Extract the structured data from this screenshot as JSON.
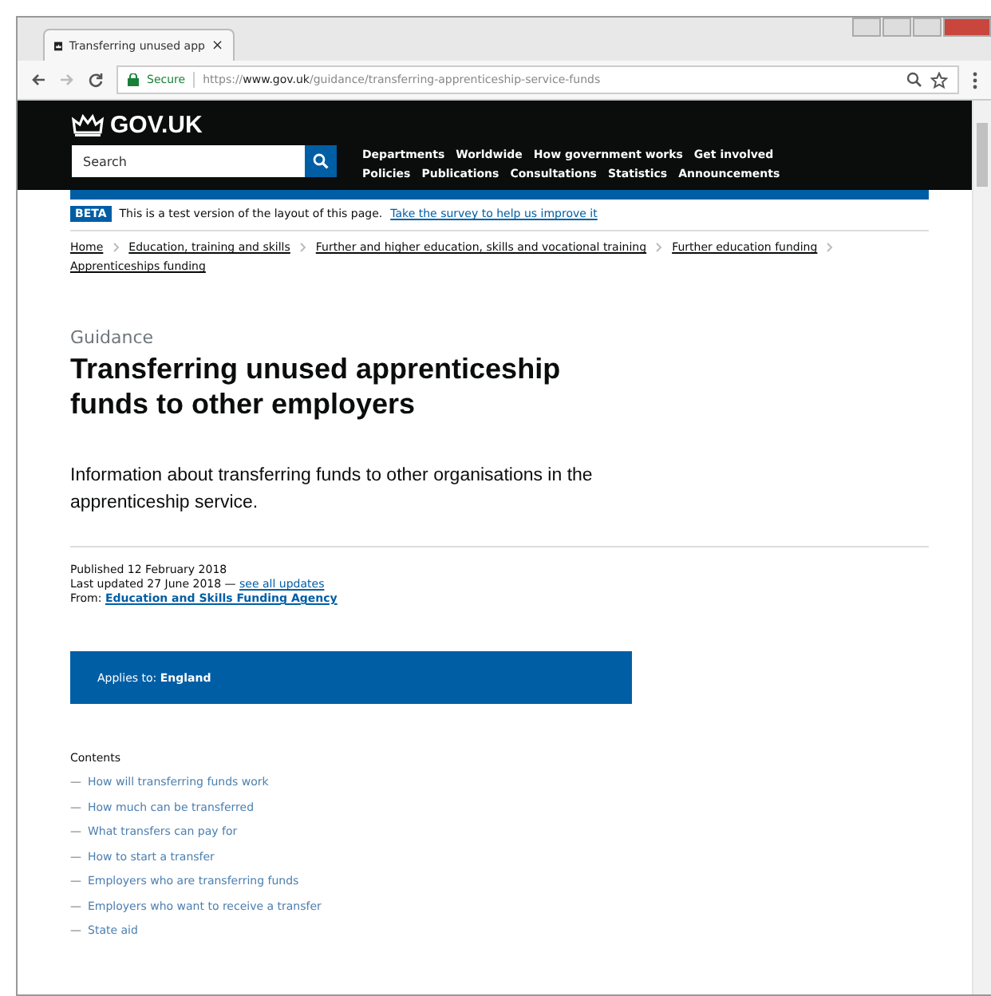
{
  "browser": {
    "tab_title": "Transferring unused app",
    "tab_close": "×",
    "url_secure": "Secure",
    "url_prefix": "https://",
    "url_host": "www.gov.uk",
    "url_path": "/guidance/transferring-apprenticeship-service-funds"
  },
  "header": {
    "logo": "GOV.UK",
    "search": {
      "placeholder": "Search"
    },
    "nav_rows": [
      [
        "Departments",
        "Worldwide",
        "How government works",
        "Get involved"
      ],
      [
        "Policies",
        "Publications",
        "Consultations",
        "Statistics",
        "Announcements"
      ]
    ]
  },
  "beta": {
    "tag": "BETA",
    "text": "This is a test version of the layout of this page.",
    "link": "Take the survey to help us improve it"
  },
  "breadcrumbs": [
    "Home",
    "Education, training and skills",
    "Further and higher education, skills and vocational training",
    "Further education funding",
    "Apprenticeships funding"
  ],
  "format": "Guidance",
  "title": "Transferring unused apprenticeship funds to other employers",
  "summary": "Information about transferring funds to other organisations in the apprenticeship service.",
  "meta": {
    "published": "Published 12 February 2018",
    "updated": "Last updated 27 June 2018 —",
    "updates_link": "see all updates",
    "from_label": "From:",
    "from_link": "Education and Skills Funding Agency"
  },
  "applies": {
    "label": "Applies to:",
    "value": "England"
  },
  "contents": {
    "heading": "Contents",
    "items": [
      {
        "dash": "—",
        "label": "How will transferring funds work"
      },
      {
        "dash": "—",
        "label": "How much can be transferred"
      },
      {
        "dash": "—",
        "label": "What transfers can pay for"
      },
      {
        "dash": "—",
        "label": "How to start a transfer"
      },
      {
        "dash": "—",
        "label": "Employers who are transferring funds"
      },
      {
        "dash": "—",
        "label": "Employers who want to receive a transfer"
      },
      {
        "dash": "—",
        "label": "State aid"
      }
    ]
  }
}
